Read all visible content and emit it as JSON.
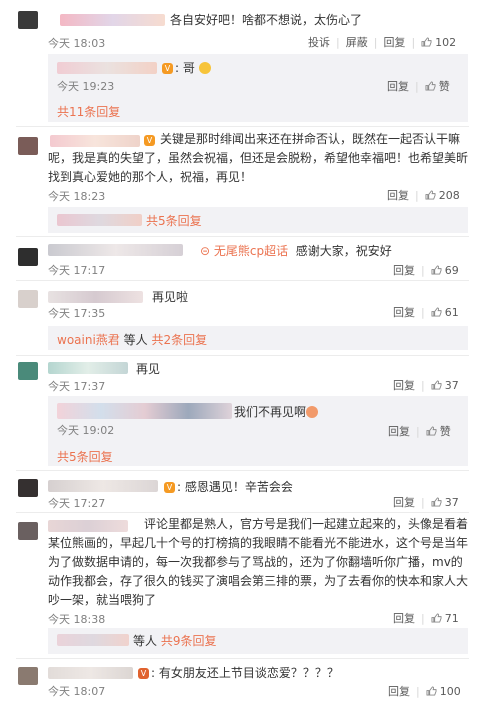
{
  "comments": [
    {
      "text": "各自安好吧！啥都不想说，太伤心了",
      "time": "今天 18:03",
      "report": "投诉",
      "block": "屏蔽",
      "reply": "回复",
      "likes": "102"
    },
    {
      "reply_text": "哥",
      "time": "今天 19:23",
      "reply": "回复",
      "like_label": "赞",
      "more": "共11条回复"
    },
    {
      "text": "关键是那时绯闻出来还在拼命否认，既然在一起否认干嘛呢，我是真的失望了，虽然会祝福，但还是会脱粉，希望他幸福吧！也希望美昕找到真心爱她的那个人，祝福，再见！",
      "time": "今天 18:23",
      "reply": "回复",
      "likes": "208"
    },
    {
      "more": "共5条回复"
    },
    {
      "tag": "无尾熊cp超话",
      "text": "感谢大家，祝安好",
      "time": "今天 17:17",
      "reply": "回复",
      "likes": "69"
    },
    {
      "text": "再见啦",
      "time": "今天 17:35",
      "reply": "回复",
      "likes": "61"
    },
    {
      "user": "woaini燕君",
      "text": "等人",
      "more": "共2条回复"
    },
    {
      "text": "再见",
      "time": "今天 17:37",
      "reply": "回复",
      "likes": "37"
    },
    {
      "reply_text": "我们不再见啊",
      "time": "今天 19:02",
      "reply": "回复",
      "like_label": "赞",
      "more": "共5条回复"
    },
    {
      "text": "感恩遇见！辛苦会会",
      "time": "今天 17:27",
      "reply": "回复",
      "likes": "37"
    },
    {
      "text": "评论里都是熟人，官方号是我们一起建立起来的，头像是看着某位熊画的，早起几十个号的打榜搞的我眼睛不能看光不能进水，这个号是当年为了做数据申请的，每一次我都参与了骂战的，还为了你翻墙听你广播，mv的动作我都会，存了很久的钱买了演唱会第三排的票，为了去看你的快本和家人大吵一架，就当喂狗了",
      "time": "今天 18:38",
      "reply": "回复",
      "likes": "71"
    },
    {
      "text": "等人",
      "more": "共9条回复"
    },
    {
      "text": "有女朋友还上节目谈恋爱？？？？",
      "time": "今天 18:07",
      "reply": "回复",
      "likes": "100"
    }
  ]
}
